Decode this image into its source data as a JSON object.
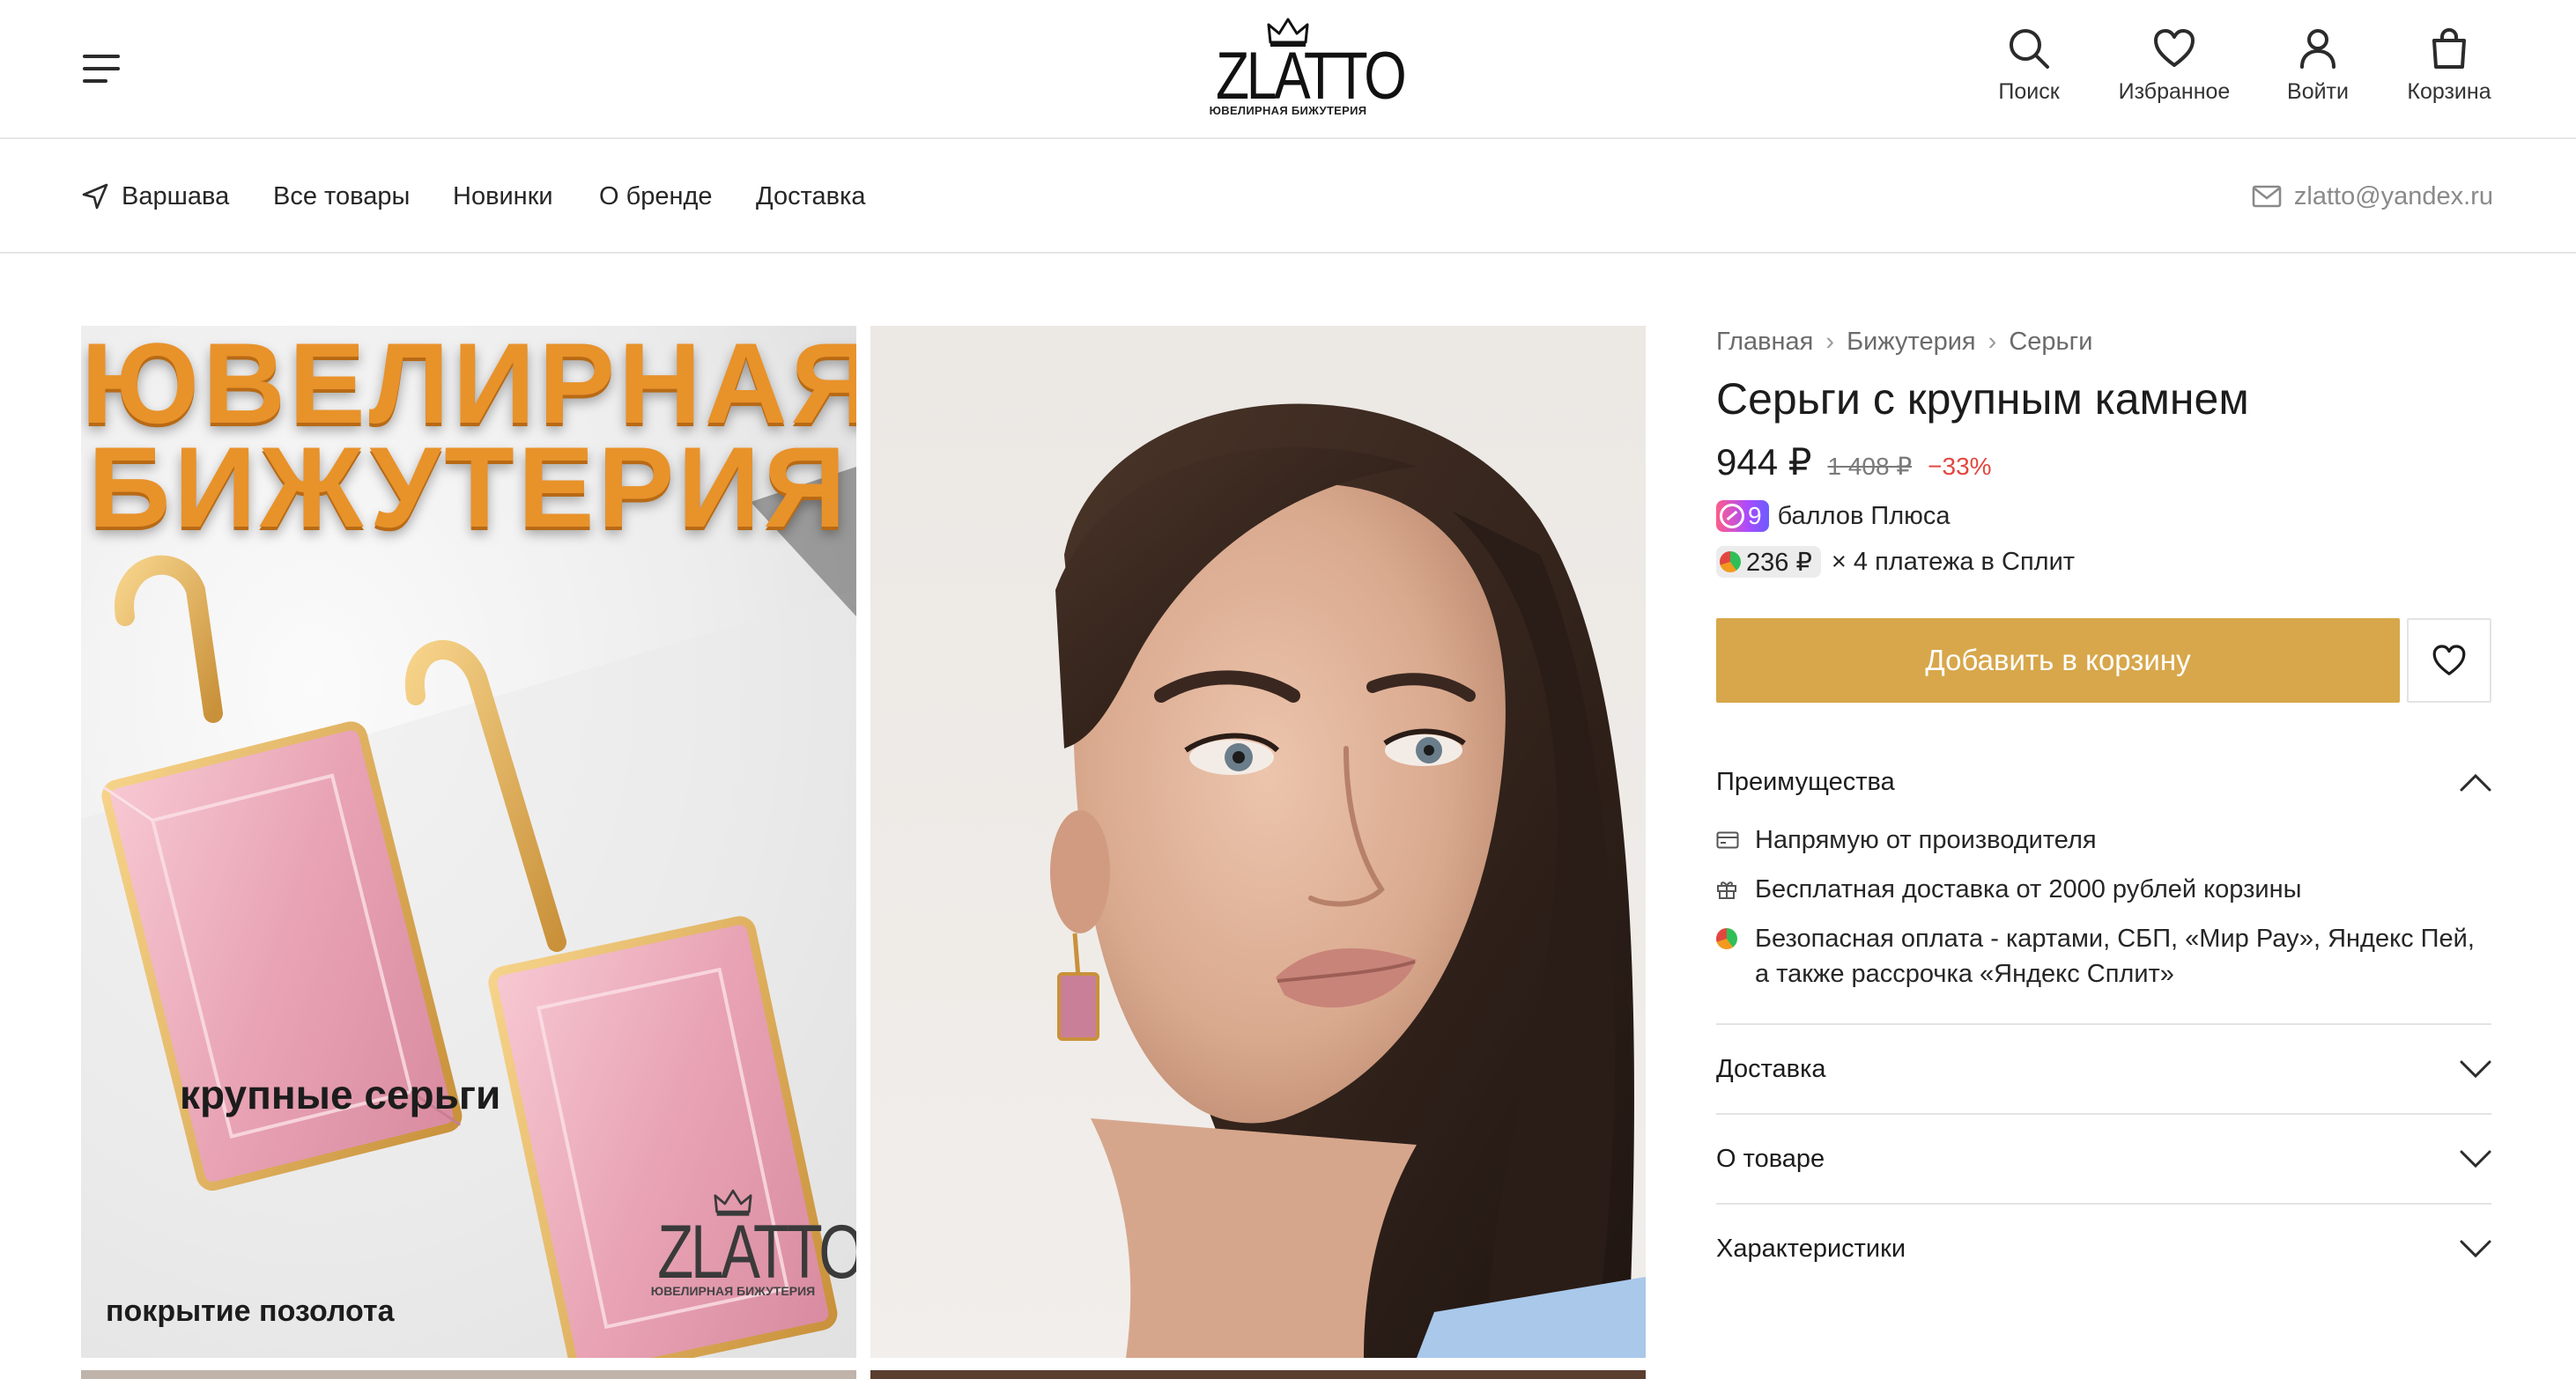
{
  "header": {
    "logo": {
      "name": "ZLATTO",
      "tagline": "ЮВЕЛИРНАЯ БИЖУТЕРИЯ"
    },
    "actions": [
      {
        "icon": "search-icon",
        "label": "Поиск"
      },
      {
        "icon": "heart-icon",
        "label": "Избранное"
      },
      {
        "icon": "user-icon",
        "label": "Войти"
      },
      {
        "icon": "bag-icon",
        "label": "Корзина"
      }
    ]
  },
  "subnav": {
    "city": "Варшава",
    "links": [
      "Все товары",
      "Новинки",
      "О бренде",
      "Доставка"
    ],
    "email": "zlatto@yandex.ru"
  },
  "gallery": {
    "promo": {
      "title_line1": "ЮВЕЛИРНАЯ",
      "title_line2": "БИЖУТЕРИЯ",
      "subtitle": "крупные серьги",
      "coating": "покрытие позолота",
      "logo_name": "ZLATTO",
      "logo_tagline": "ЮВЕЛИРНАЯ БИЖУТЕРИЯ"
    }
  },
  "product": {
    "breadcrumbs": [
      "Главная",
      "Бижутерия",
      "Серьги"
    ],
    "breadcrumb_separator": "›",
    "title": "Серьги с крупным камнем",
    "price": "944 ₽",
    "old_price": "1 408 ₽",
    "discount": "−33%",
    "plus_points": "9",
    "plus_label": "баллов Плюса",
    "split_amount": "236 ₽",
    "split_label": "× 4 платежа в Сплит",
    "add_to_cart": "Добавить в корзину"
  },
  "accordion": {
    "advantages": {
      "title": "Преимущества",
      "expanded": true,
      "items": [
        {
          "icon": "card-icon",
          "text": "Напрямую от производителя"
        },
        {
          "icon": "gift-icon",
          "text": "Бесплатная доставка от 2000 рублей корзины"
        },
        {
          "icon": "split-icon",
          "text": "Безопасная оплата - картами, СБП, «Мир Рау», Яндекс Пей, а также рассрочка «Яндекс Сплит»"
        }
      ]
    },
    "sections": [
      "Доставка",
      "О товаре",
      "Характеристики"
    ]
  },
  "colors": {
    "accent": "#d8a74b",
    "discount": "#e2473f",
    "divider": "#e3e3e3"
  }
}
